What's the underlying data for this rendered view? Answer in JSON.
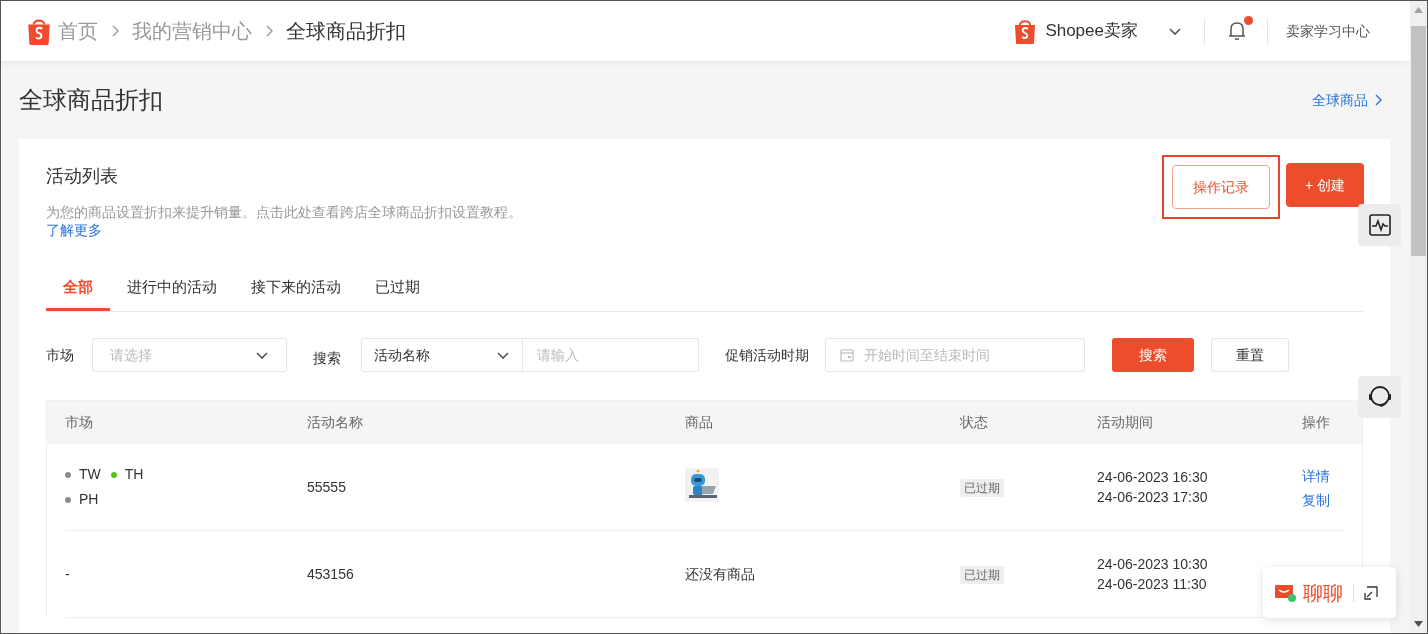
{
  "breadcrumb": [
    {
      "label": "首页",
      "current": false
    },
    {
      "label": "我的营销中心",
      "current": false
    },
    {
      "label": "全球商品折扣",
      "current": true
    }
  ],
  "header": {
    "shop_label": "Shopee卖家",
    "notification_dot": true,
    "learning_center": "卖家学习中心"
  },
  "page_title": "全球商品折扣",
  "global_products_link": "全球商品",
  "card": {
    "title": "活动列表",
    "description": "为您的商品设置折扣来提升销量。点击此处查看跨店全球商品折扣设置教程。",
    "learn_more": "了解更多",
    "record_button": {
      "label": "操作记录",
      "highlighted": true
    },
    "create_button": "+ 创建"
  },
  "tabs": [
    {
      "label": "全部",
      "selected": true
    },
    {
      "label": "进行中的活动",
      "selected": false
    },
    {
      "label": "接下来的活动",
      "selected": false
    },
    {
      "label": "已过期",
      "selected": false
    }
  ],
  "filters": {
    "market_label": "市场",
    "market_placeholder": "请选择",
    "search_label": "搜索",
    "search_type": "活动名称",
    "search_placeholder": "请输入",
    "period_label": "促销活动时期",
    "period_placeholder": "开始时间至结束时间",
    "search_button": "搜索",
    "reset_button": "重置"
  },
  "table": {
    "columns": [
      "市场",
      "活动名称",
      "商品",
      "状态",
      "活动期间",
      "操作"
    ],
    "rows": [
      {
        "markets": [
          {
            "code": "TW",
            "color": "#8c8c8c"
          },
          {
            "code": "TH",
            "color": "#52c41a"
          },
          {
            "code": "PH",
            "color": "#8c8c8c"
          }
        ],
        "name": "55555",
        "products": {
          "kind": "picture"
        },
        "status": "已过期",
        "start": "24-06-2023 16:30",
        "end": "24-06-2023 17:30",
        "actions": [
          "详情",
          "复制"
        ]
      },
      {
        "markets_text": "-",
        "name": "453156",
        "products": {
          "kind": "text",
          "text": "还没有商品"
        },
        "status": "已过期",
        "start": "24-06-2023 10:30",
        "end": "24-06-2023 11:30"
      }
    ]
  },
  "chat": {
    "label": "聊聊"
  }
}
